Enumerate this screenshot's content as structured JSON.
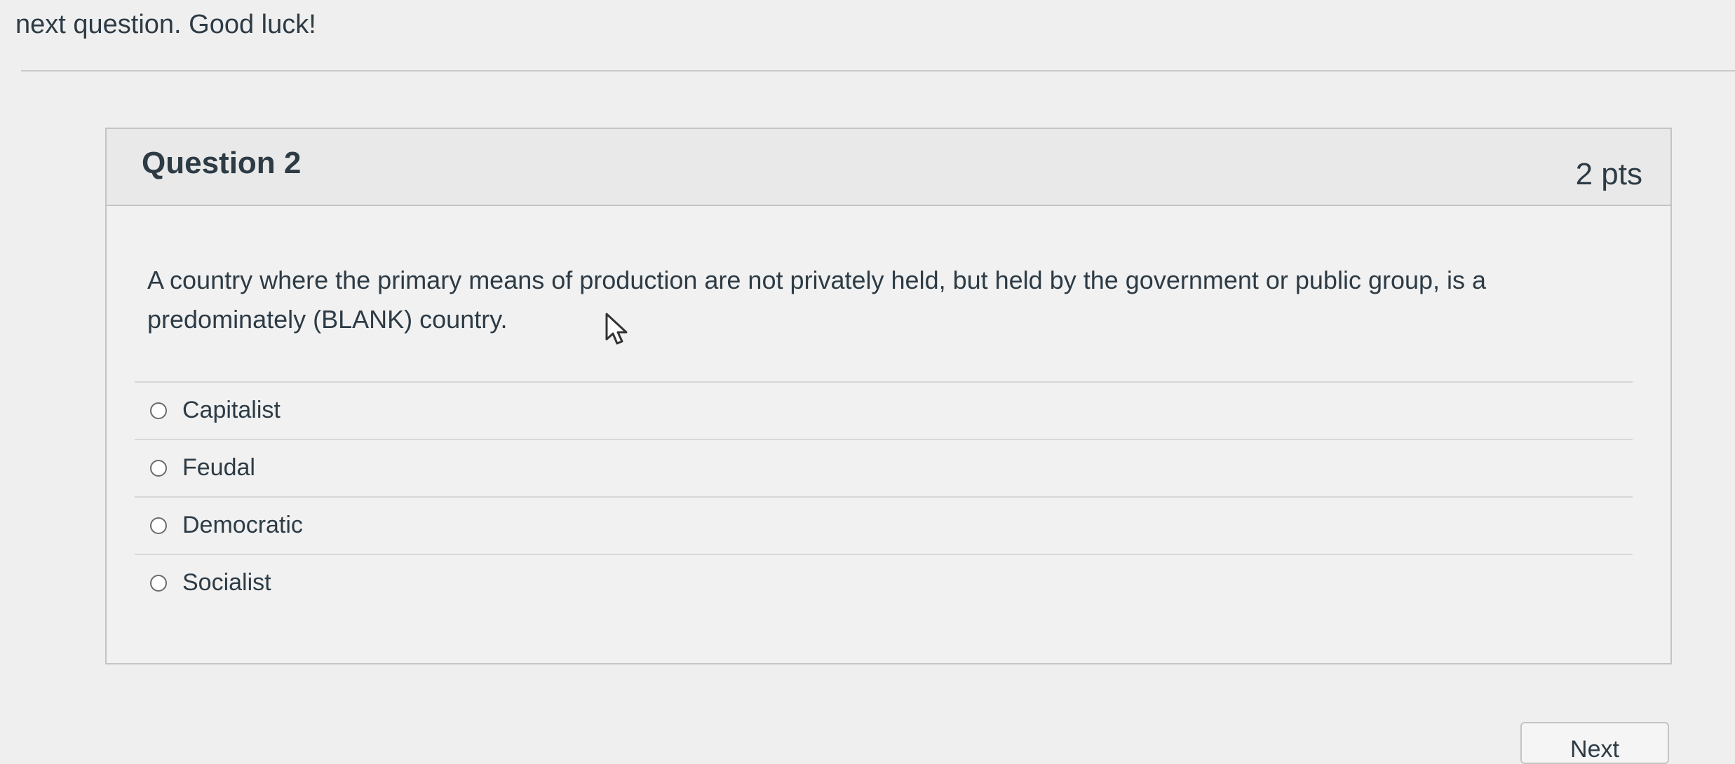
{
  "page": {
    "intro_text": "next question. Good luck!"
  },
  "question": {
    "title": "Question 2",
    "points": "2 pts",
    "text": "A country where the primary means of production are not privately held, but held by the government or public group, is a predominately (BLANK) country.",
    "answers": [
      {
        "label": "Capitalist",
        "selected": false
      },
      {
        "label": "Feudal",
        "selected": false
      },
      {
        "label": "Democratic",
        "selected": false
      },
      {
        "label": "Socialist",
        "selected": false
      }
    ]
  },
  "navigation": {
    "next_label": "Next"
  },
  "colors": {
    "page_background": "#efefef",
    "card_header": "#e9e9e9",
    "text": "#2d3b45",
    "border": "#c4c4c4"
  }
}
